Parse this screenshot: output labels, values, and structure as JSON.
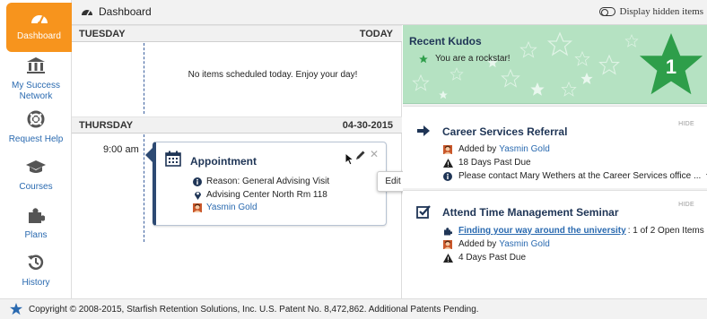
{
  "nav": {
    "items": [
      {
        "label": "Dashboard",
        "icon": "dashboard-icon",
        "active": true
      },
      {
        "label": "My Success Network",
        "icon": "building-icon"
      },
      {
        "label": "Request Help",
        "icon": "lifebuoy-icon"
      },
      {
        "label": "Courses",
        "icon": "graduation-cap-icon"
      },
      {
        "label": "Plans",
        "icon": "puzzle-icon"
      },
      {
        "label": "History",
        "icon": "history-icon"
      }
    ]
  },
  "topbar": {
    "breadcrumb": "Dashboard",
    "toggle_label": "Display hidden items"
  },
  "agenda": {
    "today": {
      "day": "TUESDAY",
      "tag": "TODAY",
      "empty_message": "No items scheduled today. Enjoy your day!"
    },
    "thursday": {
      "day": "THURSDAY",
      "date": "04-30-2015",
      "time": "9:00 am",
      "appointment": {
        "title": "Appointment",
        "reason": "Reason: General Advising Visit",
        "location": "Advising Center North Rm 118",
        "person": "Yasmin Gold",
        "tooltip": "Edit"
      }
    }
  },
  "kudos": {
    "title": "Recent Kudos",
    "message": "You are a rockstar!",
    "count": "1"
  },
  "alerts": [
    {
      "title": "Career Services Referral",
      "hide": "HIDE",
      "added_prefix": "Added by ",
      "added_by": "Yasmin Gold",
      "past_due": "18 Days Past Due",
      "info": "Please contact Mary Wethers at the Career Services office ..."
    },
    {
      "title": "Attend Time Management Seminar",
      "hide": "HIDE",
      "plan_link": "Finding your way around the university",
      "plan_suffix": ": 1 of 2 Open Items",
      "added_prefix": "Added by ",
      "added_by": "Yasmin Gold",
      "past_due": "4 Days Past Due"
    }
  ],
  "footer": {
    "copyright": "Copyright © 2008-2015, Starfish Retention Solutions, Inc. U.S. Patent No. 8,472,862. Additional Patents Pending."
  },
  "colors": {
    "brand_orange": "#f7941d",
    "navy": "#1f3556",
    "link_blue": "#2a6ab0",
    "kudos_green": "#b5e2c2",
    "star_green": "#2e9e4a"
  }
}
